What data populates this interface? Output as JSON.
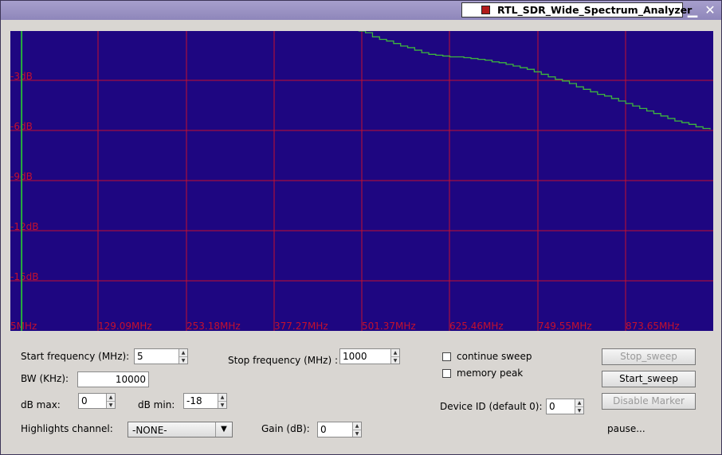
{
  "window": {
    "title": "RTL_SDR_Wide_Spectrum_Analyzer",
    "minimize_glyph": "▁",
    "close_glyph": "✕"
  },
  "plot": {
    "background": "#1e0681",
    "grid_color": "#c4102e",
    "trace_color": "#3db53d",
    "marker_color": "#27b03d",
    "y_labels": [
      "-3dB",
      "-6dB",
      "-9dB",
      "-12dB",
      "-15dB"
    ],
    "x_labels": [
      "5MHz",
      "129.09MHz",
      "253.18MHz",
      "377.27MHz",
      "501.37MHz",
      "625.46MHz",
      "749.55MHz",
      "873.65MHz"
    ]
  },
  "chart_data": {
    "type": "line",
    "xlabel": "",
    "ylabel": "",
    "xlim": [
      5,
      1000
    ],
    "ylim": [
      -18,
      0
    ],
    "x_ticks": [
      "5MHz",
      "129.09MHz",
      "253.18MHz",
      "377.27MHz",
      "501.37MHz",
      "625.46MHz",
      "749.55MHz",
      "873.65MHz"
    ],
    "y_ticks": [
      "-3dB",
      "-6dB",
      "-9dB",
      "-12dB",
      "-15dB"
    ],
    "grid": true,
    "series": [
      {
        "x": [
          500,
          510,
          520,
          530,
          540,
          550,
          560,
          570,
          580,
          590,
          600,
          610,
          620,
          630,
          640,
          650,
          660,
          670,
          680,
          690,
          700,
          710,
          720,
          730,
          740,
          750,
          760,
          770,
          780,
          790,
          800,
          810,
          820,
          830,
          840,
          850,
          860,
          870,
          880,
          890,
          900,
          910,
          920,
          930,
          940,
          950,
          960,
          970,
          980,
          990,
          1000
        ],
        "y": [
          0,
          -0.1,
          -0.35,
          -0.5,
          -0.6,
          -0.75,
          -0.9,
          -1.0,
          -1.15,
          -1.3,
          -1.4,
          -1.45,
          -1.5,
          -1.55,
          -1.55,
          -1.6,
          -1.65,
          -1.7,
          -1.75,
          -1.85,
          -1.9,
          -2.0,
          -2.1,
          -2.2,
          -2.3,
          -2.45,
          -2.6,
          -2.75,
          -2.9,
          -3.0,
          -3.15,
          -3.35,
          -3.5,
          -3.65,
          -3.8,
          -3.9,
          -4.05,
          -4.2,
          -4.35,
          -4.5,
          -4.65,
          -4.8,
          -4.95,
          -5.1,
          -5.25,
          -5.4,
          -5.5,
          -5.6,
          -5.75,
          -5.85,
          -5.9
        ]
      }
    ],
    "marker_x": 21
  },
  "controls": {
    "start_freq_label": "Start frequency (MHz):",
    "start_freq_value": "5",
    "stop_freq_label": "Stop frequency (MHz) :",
    "stop_freq_value": "1000",
    "bw_label": "BW (KHz):",
    "bw_value": "10000",
    "db_max_label": "dB max:",
    "db_max_value": "0",
    "db_min_label": "dB min:",
    "db_min_value": "-18",
    "highlights_label": "Highlights channel:",
    "highlights_value": "-NONE-",
    "gain_label": "Gain (dB):",
    "gain_value": "0",
    "continue_sweep_label": "continue sweep",
    "memory_peak_label": "memory peak",
    "device_id_label": "Device ID (default 0):",
    "device_id_value": "0",
    "stop_sweep_label": "Stop_sweep",
    "start_sweep_label": "Start_sweep",
    "disable_marker_label": "Disable Marker",
    "status_text": "pause..."
  }
}
